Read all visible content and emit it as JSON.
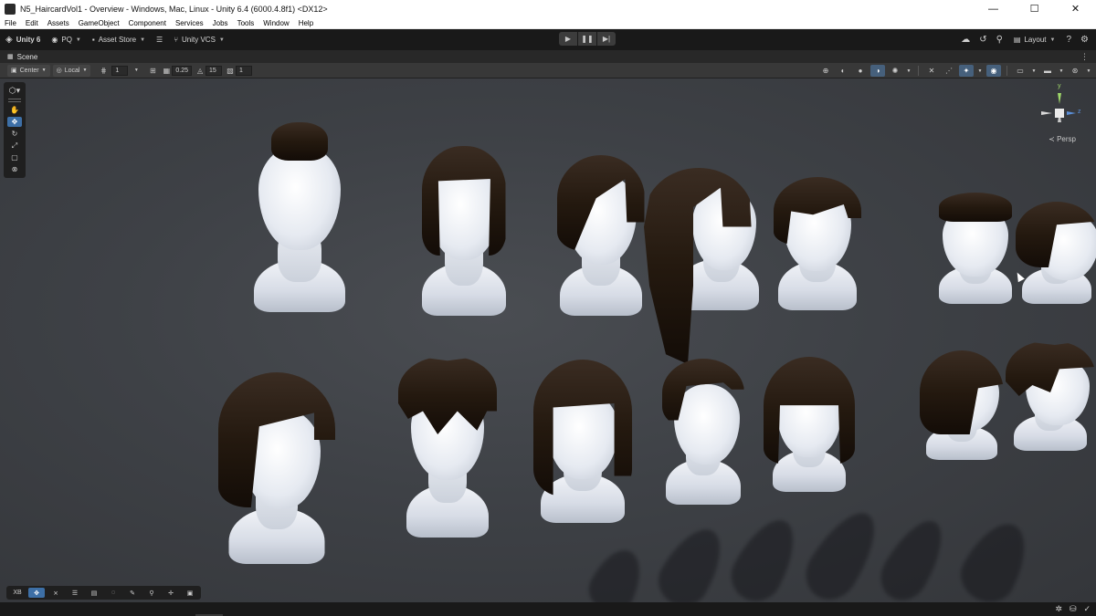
{
  "window": {
    "title": "N5_HaircardVol1 - Overview - Windows, Mac, Linux - Unity 6.4 (6000.4.8f1) <DX12>",
    "controls": {
      "minimize": "—",
      "maximize": "☐",
      "close": "✕"
    }
  },
  "menu": [
    "File",
    "Edit",
    "Assets",
    "GameObject",
    "Component",
    "Services",
    "Jobs",
    "Tools",
    "Window",
    "Help"
  ],
  "toolbar": {
    "unity_label": "Unity 6",
    "account_label": "PQ",
    "asset_store_label": "Asset Store",
    "vcs_label": "Unity VCS",
    "layout_label": "Layout"
  },
  "scene_tab": {
    "label": "Scene"
  },
  "scene_toolbar": {
    "pivot_label": "Center",
    "space_label": "Local",
    "grid_value": "1",
    "snap_increment": "0.25",
    "rotate_snap": "15",
    "scale_snap": "1"
  },
  "gizmo": {
    "axis_y": "y",
    "axis_z": "z",
    "projection_label": "≺ Persp"
  },
  "bottom_tools": {
    "first_label": "XB"
  }
}
